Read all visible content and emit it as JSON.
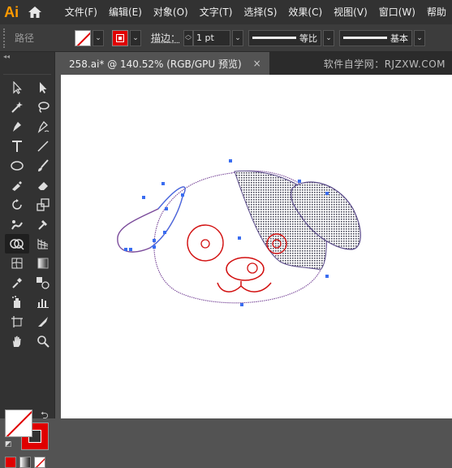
{
  "app": {
    "logo": "Ai"
  },
  "menu": [
    "文件(F)",
    "编辑(E)",
    "对象(O)",
    "文字(T)",
    "选择(S)",
    "效果(C)",
    "视图(V)",
    "窗口(W)",
    "帮助"
  ],
  "control_bar": {
    "selection_label": "路径",
    "stroke_label": "描边",
    "stroke_weight": "1 pt",
    "profile_label": "等比",
    "brush_label": "基本"
  },
  "tab": {
    "title": "258.ai* @ 140.52% (RGB/GPU 预览)",
    "close": "×"
  },
  "watermark": "软件自学网：RJZXW.COM",
  "colors": {
    "accent_logo": "#ff9a00",
    "stroke": "#e00000",
    "path_selection": "#3a6df0",
    "purple_path": "#7a4a9a"
  },
  "tools": [
    [
      "selection-arrow-icon",
      "direct-selection-icon"
    ],
    [
      "magic-wand-icon",
      "lasso-icon"
    ],
    [
      "pen-icon",
      "curvature-pen-icon"
    ],
    [
      "type-icon",
      "line-segment-icon"
    ],
    [
      "ellipse-icon",
      "paintbrush-icon"
    ],
    [
      "shaper-icon",
      "eraser-icon"
    ],
    [
      "rotate-icon",
      "scale-icon"
    ],
    [
      "puppet-warp-icon",
      "free-transform-icon"
    ],
    [
      "shape-builder-icon",
      "perspective-grid-icon"
    ],
    [
      "mesh-icon",
      "gradient-icon"
    ],
    [
      "eyedropper-icon",
      "blend-icon"
    ],
    [
      "symbol-sprayer-icon",
      "column-graph-icon"
    ],
    [
      "artboard-icon",
      "slice-icon"
    ],
    [
      "hand-icon",
      "zoom-icon"
    ]
  ],
  "active_tool": "shape-builder-icon"
}
